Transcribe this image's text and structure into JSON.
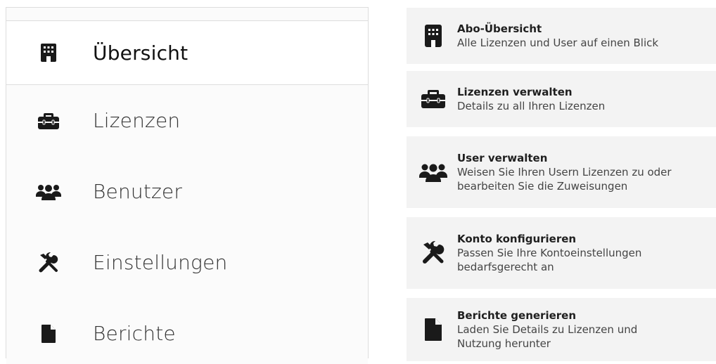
{
  "nav": {
    "items": [
      {
        "label": "Übersicht",
        "icon": "building-icon",
        "active": true
      },
      {
        "label": "Lizenzen",
        "icon": "briefcase-icon",
        "active": false
      },
      {
        "label": "Benutzer",
        "icon": "users-icon",
        "active": false
      },
      {
        "label": "Einstellungen",
        "icon": "tools-icon",
        "active": false
      },
      {
        "label": "Berichte",
        "icon": "document-icon",
        "active": false
      }
    ]
  },
  "cards": [
    {
      "title": "Abo-Übersicht",
      "desc_line1": "Alle Lizenzen und User auf einen Blick",
      "desc_line2": "",
      "icon": "building-icon"
    },
    {
      "title": "Lizenzen verwalten",
      "desc_line1": "Details zu all Ihren Lizenzen",
      "desc_line2": "",
      "icon": "briefcase-icon"
    },
    {
      "title": "User verwalten",
      "desc_line1": "Weisen Sie Ihren Usern Lizenzen zu oder",
      "desc_line2": "bearbeiten Sie die Zuweisungen",
      "icon": "users-icon"
    },
    {
      "title": "Konto konfigurieren",
      "desc_line1": "Passen Sie Ihre Kontoeinstellungen",
      "desc_line2": "bedarfsgerecht an",
      "icon": "tools-icon"
    },
    {
      "title": "Berichte generieren",
      "desc_line1": "Laden Sie Details zu Lizenzen und",
      "desc_line2": "Nutzung herunter",
      "icon": "document-icon"
    }
  ],
  "colors": {
    "card_bg": "#f3f3f3",
    "nav_border": "#dddddd",
    "icon_color": "#1a1a1a"
  }
}
